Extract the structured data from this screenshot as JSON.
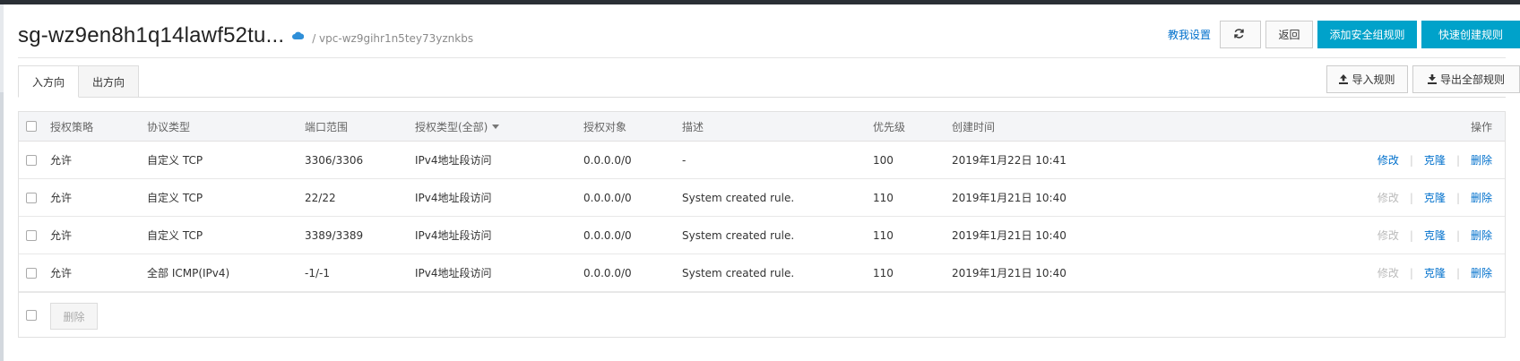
{
  "header": {
    "title": "sg-wz9en8h1q14lawf52tu...",
    "vpc_path": "/ vpc-wz9gihr1n5tey73yznkbs",
    "teach_link": "教我设置",
    "back_label": "返回",
    "add_rule_label": "添加安全组规则",
    "quick_create_label": "快速创建规则"
  },
  "tabs": [
    {
      "label": "入方向",
      "active": true
    },
    {
      "label": "出方向",
      "active": false
    }
  ],
  "tab_actions": {
    "import_label": "导入规则",
    "export_label": "导出全部规则"
  },
  "table": {
    "columns": {
      "policy": "授权策略",
      "protocol": "协议类型",
      "port": "端口范围",
      "auth_type": "授权类型(全部)",
      "target": "授权对象",
      "description": "描述",
      "priority": "优先级",
      "created": "创建时间",
      "ops": "操作"
    },
    "rows": [
      {
        "policy": "允许",
        "protocol": "自定义 TCP",
        "port": "3306/3306",
        "auth_type": "IPv4地址段访问",
        "target": "0.0.0.0/0",
        "description": "-",
        "priority": "100",
        "created": "2019年1月22日 10:41",
        "edit": "修改",
        "clone": "克隆",
        "delete": "删除",
        "edit_enabled": true
      },
      {
        "policy": "允许",
        "protocol": "自定义 TCP",
        "port": "22/22",
        "auth_type": "IPv4地址段访问",
        "target": "0.0.0.0/0",
        "description": "System created rule.",
        "priority": "110",
        "created": "2019年1月21日 10:40",
        "edit": "修改",
        "clone": "克隆",
        "delete": "删除",
        "edit_enabled": false
      },
      {
        "policy": "允许",
        "protocol": "自定义 TCP",
        "port": "3389/3389",
        "auth_type": "IPv4地址段访问",
        "target": "0.0.0.0/0",
        "description": "System created rule.",
        "priority": "110",
        "created": "2019年1月21日 10:40",
        "edit": "修改",
        "clone": "克隆",
        "delete": "删除",
        "edit_enabled": false
      },
      {
        "policy": "允许",
        "protocol": "全部 ICMP(IPv4)",
        "port": "-1/-1",
        "auth_type": "IPv4地址段访问",
        "target": "0.0.0.0/0",
        "description": "System created rule.",
        "priority": "110",
        "created": "2019年1月21日 10:40",
        "edit": "修改",
        "clone": "克隆",
        "delete": "删除",
        "edit_enabled": false
      }
    ],
    "footer_delete_label": "删除"
  },
  "colors": {
    "primary": "#00a2ca",
    "link": "#0070cc",
    "disabled": "#bbbbbb",
    "topbar": "#2a2f35"
  }
}
